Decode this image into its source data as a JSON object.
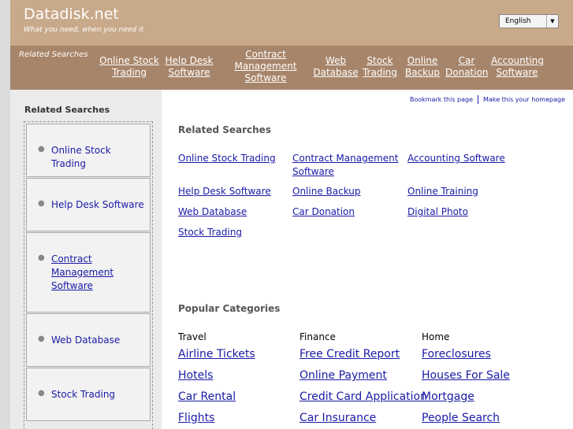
{
  "header": {
    "site_title": "Datadisk.net",
    "tagline": "What you need, when you need it",
    "language": "English"
  },
  "nav": {
    "label": "Related Searches",
    "links": [
      "Online Stock Trading",
      "Help Desk Software",
      "Contract Management Software",
      "Web Database",
      "Stock Trading",
      "Online Backup",
      "Car Donation",
      "Accounting Software"
    ]
  },
  "sidebar": {
    "title": "Related Searches",
    "items": [
      "Online Stock Trading",
      "Help Desk Software",
      "Contract Management Software",
      "Web Database",
      "Stock Trading"
    ]
  },
  "toplinks": {
    "bookmark": "Bookmark this page",
    "homepage": "Make this your homepage"
  },
  "related": {
    "title": "Related Searches",
    "links": [
      "Online Stock Trading",
      "Contract Management Software",
      "Accounting Software",
      "Help Desk Software",
      "Online Backup",
      "Online Training",
      "Web Database",
      "Car Donation",
      "Digital Photo",
      "Stock Trading"
    ]
  },
  "popular": {
    "title": "Popular Categories",
    "columns": [
      {
        "heading": "Travel",
        "links": [
          "Airline Tickets",
          "Hotels",
          "Car Rental",
          "Flights"
        ]
      },
      {
        "heading": "Finance",
        "links": [
          "Free Credit Report",
          "Online Payment",
          "Credit Card Application",
          "Car Insurance"
        ]
      },
      {
        "heading": "Home",
        "links": [
          "Foreclosures",
          "Houses For Sale",
          "Mortgage",
          "People Search"
        ]
      }
    ]
  }
}
